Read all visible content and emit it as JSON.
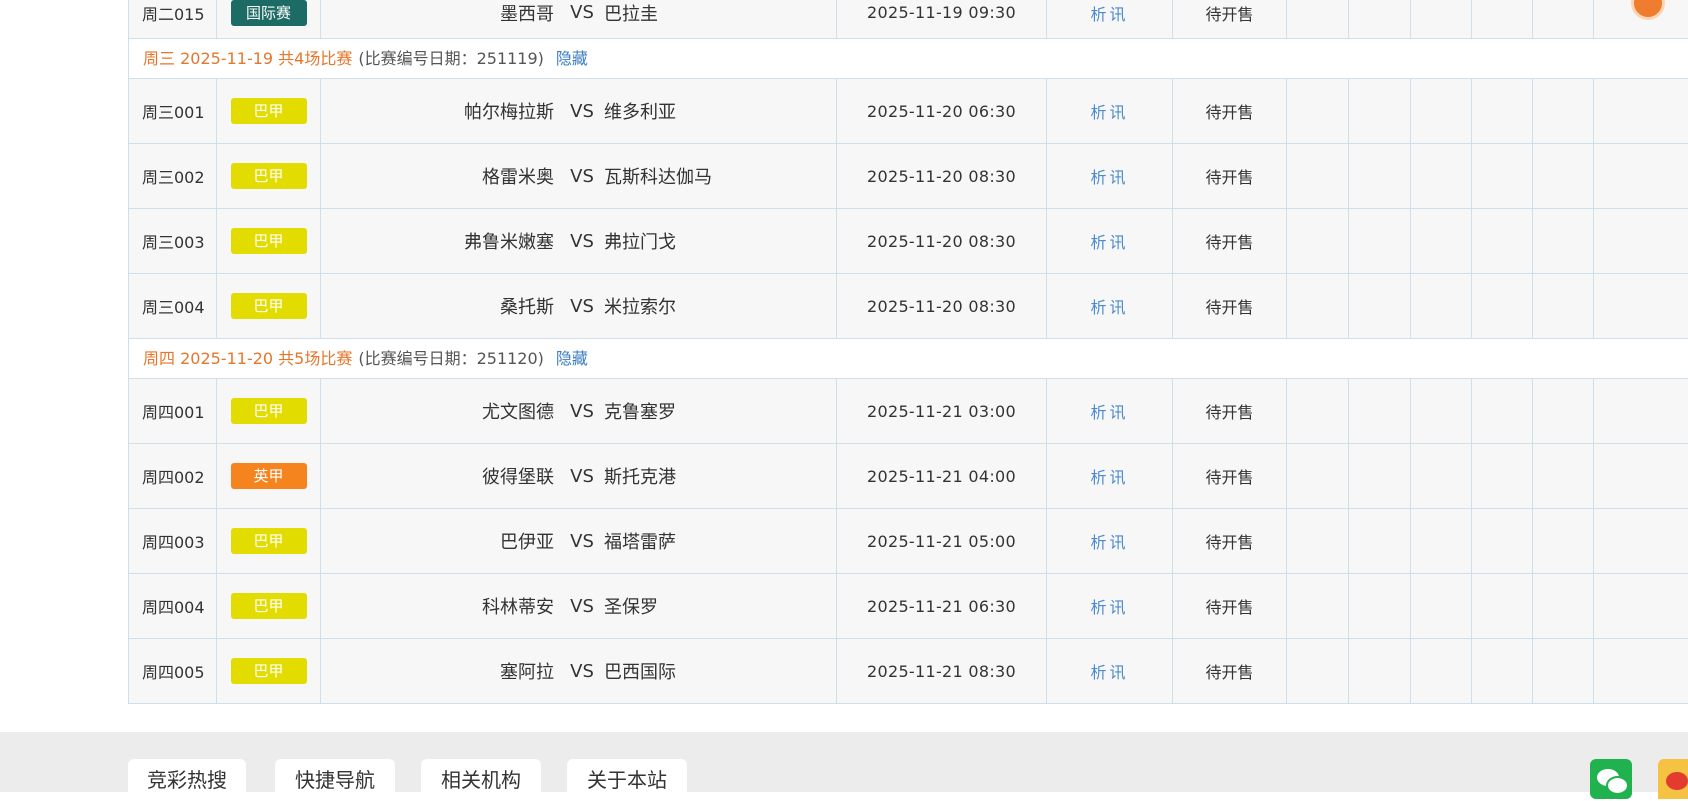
{
  "colors": {
    "section_header": "#e6762a",
    "link": "#3b7dc4",
    "analysis": "#4a8ad0",
    "league_serie_b": "#e3dc00",
    "league_intl": "#1c6b64",
    "league_efl": "#f5841f",
    "row_bg": "#f7f7f7",
    "grid_line": "#cfe0ea"
  },
  "top_row": {
    "num": "周二015",
    "league": "国际赛",
    "league_color": "#1c6b64",
    "home": "墨西哥",
    "vs": "VS",
    "away": "巴拉圭",
    "time": "2025-11-19 09:30",
    "analysis": "析讯",
    "status": "待开售"
  },
  "sections": [
    {
      "header": "周三 2025-11-19 共4场比赛",
      "note": "(比赛编号日期：251119)",
      "toggle": "隐藏",
      "matches": [
        {
          "num": "周三001",
          "league": "巴甲",
          "league_color": "#e3dc00",
          "home": "帕尔梅拉斯",
          "vs": "VS",
          "away": "维多利亚",
          "time": "2025-11-20 06:30",
          "analysis": "析讯",
          "status": "待开售"
        },
        {
          "num": "周三002",
          "league": "巴甲",
          "league_color": "#e3dc00",
          "home": "格雷米奥",
          "vs": "VS",
          "away": "瓦斯科达伽马",
          "time": "2025-11-20 08:30",
          "analysis": "析讯",
          "status": "待开售"
        },
        {
          "num": "周三003",
          "league": "巴甲",
          "league_color": "#e3dc00",
          "home": "弗鲁米嫩塞",
          "vs": "VS",
          "away": "弗拉门戈",
          "time": "2025-11-20 08:30",
          "analysis": "析讯",
          "status": "待开售"
        },
        {
          "num": "周三004",
          "league": "巴甲",
          "league_color": "#e3dc00",
          "home": "桑托斯",
          "vs": "VS",
          "away": "米拉索尔",
          "time": "2025-11-20 08:30",
          "analysis": "析讯",
          "status": "待开售"
        }
      ]
    },
    {
      "header": "周四 2025-11-20 共5场比赛",
      "note": "(比赛编号日期：251120)",
      "toggle": "隐藏",
      "matches": [
        {
          "num": "周四001",
          "league": "巴甲",
          "league_color": "#e3dc00",
          "home": "尤文图德",
          "vs": "VS",
          "away": "克鲁塞罗",
          "time": "2025-11-21 03:00",
          "analysis": "析讯",
          "status": "待开售"
        },
        {
          "num": "周四002",
          "league": "英甲",
          "league_color": "#f5841f",
          "home": "彼得堡联",
          "vs": "VS",
          "away": "斯托克港",
          "time": "2025-11-21 04:00",
          "analysis": "析讯",
          "status": "待开售"
        },
        {
          "num": "周四003",
          "league": "巴甲",
          "league_color": "#e3dc00",
          "home": "巴伊亚",
          "vs": "VS",
          "away": "福塔雷萨",
          "time": "2025-11-21 05:00",
          "analysis": "析讯",
          "status": "待开售"
        },
        {
          "num": "周四004",
          "league": "巴甲",
          "league_color": "#e3dc00",
          "home": "科林蒂安",
          "vs": "VS",
          "away": "圣保罗",
          "time": "2025-11-21 06:30",
          "analysis": "析讯",
          "status": "待开售"
        },
        {
          "num": "周四005",
          "league": "巴甲",
          "league_color": "#e3dc00",
          "home": "塞阿拉",
          "vs": "VS",
          "away": "巴西国际",
          "time": "2025-11-21 08:30",
          "analysis": "析讯",
          "status": "待开售"
        }
      ]
    }
  ],
  "footer": {
    "tabs": [
      "竞彩热搜",
      "快捷导航",
      "相关机构",
      "关于本站"
    ],
    "icons": [
      "wechat-icon",
      "weibo-icon"
    ]
  }
}
